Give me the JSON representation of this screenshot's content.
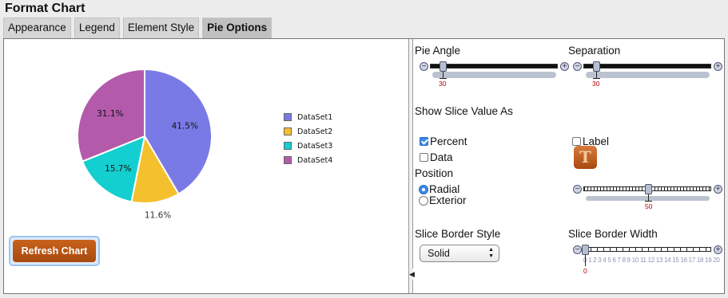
{
  "window": {
    "title": "Format Chart"
  },
  "tabs": [
    {
      "label": "Appearance",
      "active": false
    },
    {
      "label": "Legend",
      "active": false
    },
    {
      "label": "Element Style",
      "active": false
    },
    {
      "label": "Pie Options",
      "active": true
    }
  ],
  "chart_data": {
    "type": "pie",
    "title": "",
    "slices": [
      {
        "name": "DataSet1",
        "value": 41.5,
        "label": "41.5%",
        "color": "#7a7ae6"
      },
      {
        "name": "DataSet2",
        "value": 11.6,
        "label": "11.6%",
        "color": "#f5c02e"
      },
      {
        "name": "DataSet3",
        "value": 15.7,
        "label": "15.7%",
        "color": "#13cfcf"
      },
      {
        "name": "DataSet4",
        "value": 31.1,
        "label": "31.1%",
        "color": "#b35aaa"
      }
    ],
    "legend": {
      "position": "right"
    }
  },
  "refresh_button": {
    "label": "Refresh Chart"
  },
  "options": {
    "pie_angle": {
      "label": "Pie Angle",
      "value": "30"
    },
    "separation": {
      "label": "Separation",
      "value": "30"
    },
    "show_slice_value_as": {
      "label": "Show Slice Value As"
    },
    "percent": {
      "label": "Percent",
      "checked": true
    },
    "data": {
      "label": "Data",
      "checked": false
    },
    "label_check": {
      "label": "Label",
      "checked": false
    },
    "position": {
      "label": "Position"
    },
    "radial": {
      "label": "Radial",
      "selected": true
    },
    "exterior": {
      "label": "Exterior",
      "selected": false
    },
    "position_slider": {
      "value": "50"
    },
    "slice_border_style": {
      "label": "Slice Border Style",
      "value": "Solid"
    },
    "slice_border_width": {
      "label": "Slice Border Width",
      "value": "0",
      "scale": "0 1 2 3 4 5 6 7 8 9 10 11 12 13 14 15 16 17 18 19 20"
    },
    "text_icon_glyph": "T"
  }
}
